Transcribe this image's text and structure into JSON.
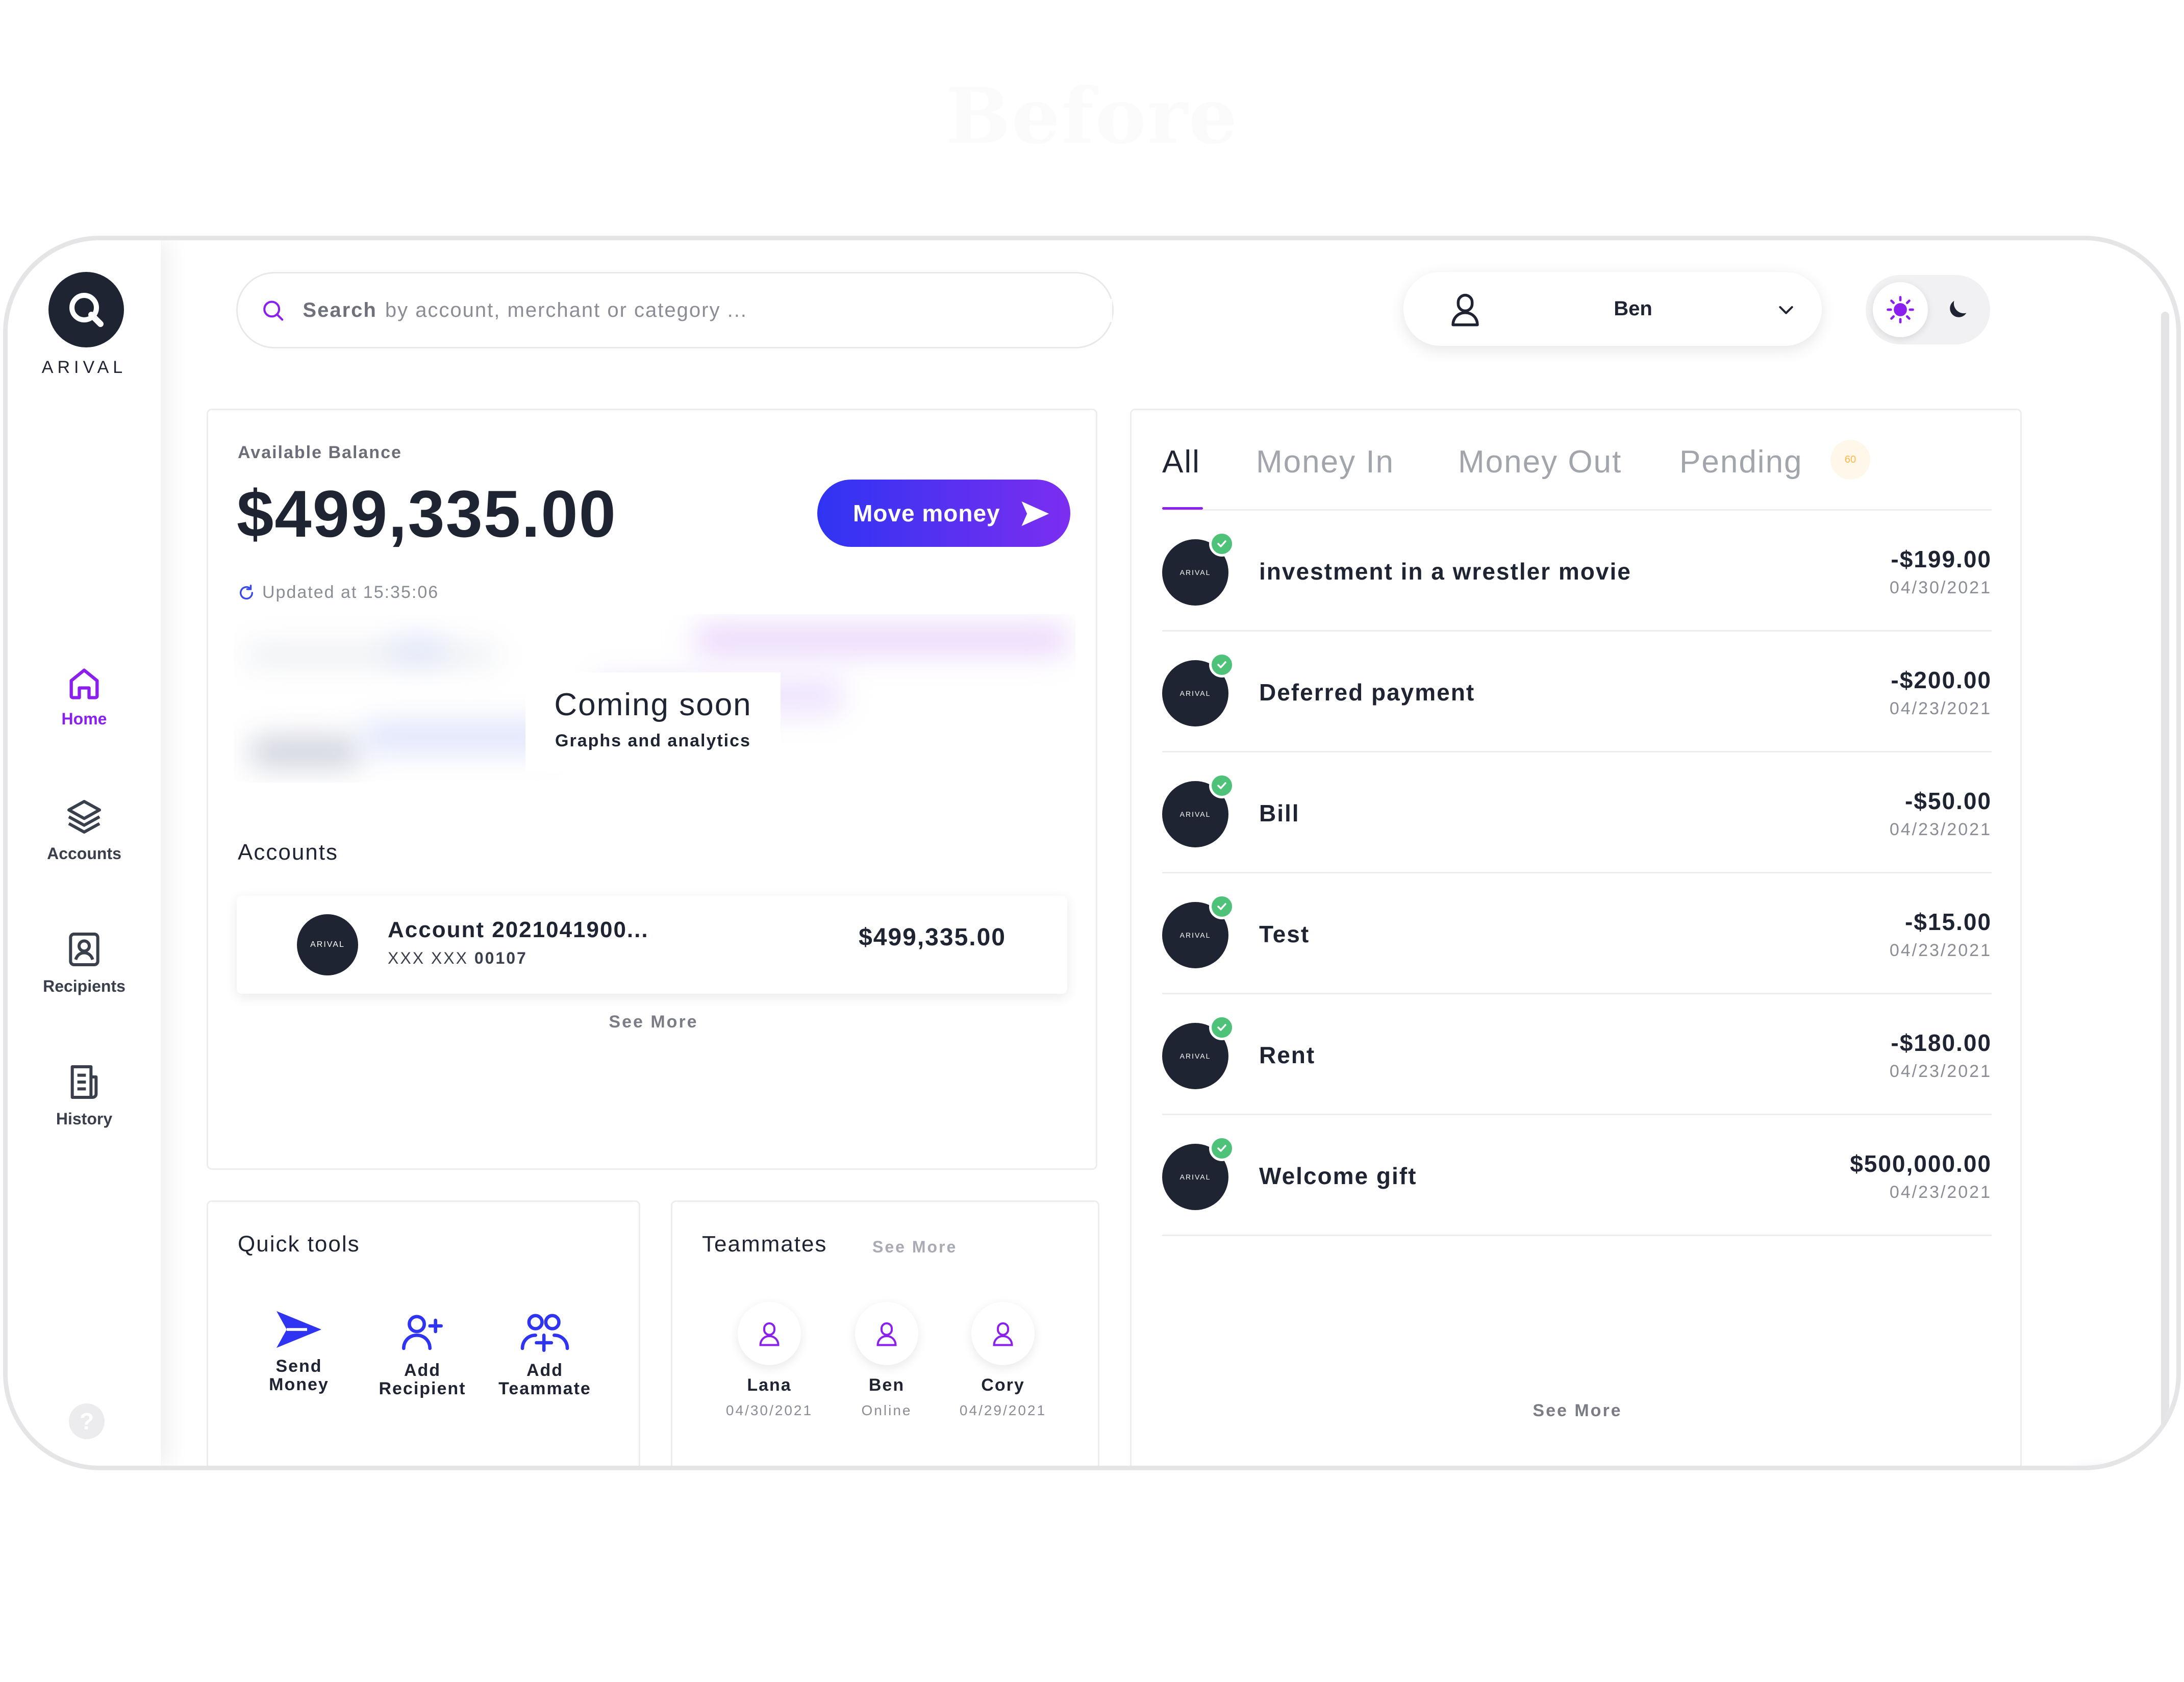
{
  "page_title": "Before",
  "brand": {
    "logo_text": "ARIVAL"
  },
  "sidebar": {
    "items": [
      {
        "label": "Home",
        "icon": "home-icon",
        "active": true
      },
      {
        "label": "Accounts",
        "icon": "layers-icon",
        "active": false
      },
      {
        "label": "Recipients",
        "icon": "contact-card-icon",
        "active": false
      },
      {
        "label": "History",
        "icon": "history-icon",
        "active": false
      }
    ],
    "help_label": "?"
  },
  "search": {
    "bold_label": "Search",
    "placeholder": "by account, merchant or category ..."
  },
  "user": {
    "name": "Ben"
  },
  "balance": {
    "label": "Available Balance",
    "value": "$499,335.00",
    "move_money_label": "Move money",
    "updated_text": "Updated at 15:35:06",
    "coming_soon_title": "Coming soon",
    "coming_soon_subtitle": "Graphs and analytics"
  },
  "accounts": {
    "title": "Accounts",
    "items": [
      {
        "logo": "ARIVAL",
        "name": "Account 2021041900...",
        "number_prefix": "XXX XXX",
        "number_suffix": "00107",
        "balance": "$499,335.00"
      }
    ],
    "see_more": "See More"
  },
  "quick_tools": {
    "title": "Quick tools",
    "tools": [
      {
        "label_line1": "Send",
        "label_line2": "Money",
        "icon": "send-icon"
      },
      {
        "label_line1": "Add",
        "label_line2": "Recipient",
        "icon": "add-user-icon"
      },
      {
        "label_line1": "Add",
        "label_line2": "Teammate",
        "icon": "add-team-icon"
      }
    ]
  },
  "teammates": {
    "title": "Teammates",
    "see_more": "See More",
    "members": [
      {
        "name": "Lana",
        "sub": "04/30/2021"
      },
      {
        "name": "Ben",
        "sub": "Online"
      },
      {
        "name": "Cory",
        "sub": "04/29/2021"
      }
    ]
  },
  "transactions": {
    "tabs": [
      "All",
      "Money In",
      "Money Out",
      "Pending"
    ],
    "active_tab": "All",
    "pending_badge": "60",
    "items": [
      {
        "logo": "ARIVAL",
        "name": "investment in a wrestler movie",
        "amount": "-$199.00",
        "date": "04/30/2021"
      },
      {
        "logo": "ARIVAL",
        "name": "Deferred payment",
        "amount": "-$200.00",
        "date": "04/23/2021"
      },
      {
        "logo": "ARIVAL",
        "name": "Bill",
        "amount": "-$50.00",
        "date": "04/23/2021"
      },
      {
        "logo": "ARIVAL",
        "name": "Test",
        "amount": "-$15.00",
        "date": "04/23/2021"
      },
      {
        "logo": "ARIVAL",
        "name": "Rent",
        "amount": "-$180.00",
        "date": "04/23/2021"
      },
      {
        "logo": "ARIVAL",
        "name": "Welcome gift",
        "amount": "$500,000.00",
        "date": "04/23/2021"
      }
    ],
    "see_more": "See More"
  },
  "colors": {
    "accent": "#8b1ff0",
    "button_gradient_start": "#2f34f2",
    "button_gradient_end": "#7c2ef0",
    "success": "#4fc27a",
    "dark": "#1f2433"
  }
}
